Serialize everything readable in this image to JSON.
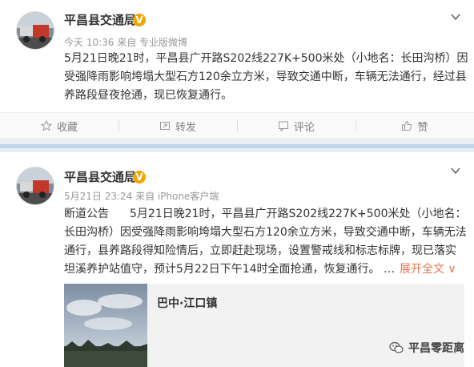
{
  "post1": {
    "author": "平昌县交通局",
    "verified_badge": "V",
    "meta": "今天 10:36 来自 专业版微博",
    "content_lines": [
      "5月21日晚21时，平昌县广开路S202线227K+500米处（小地名：长田沟桥）因",
      "受强降雨影响垮塌大型石方120余立方米，导致交通中断，车辆无法通行，经过县",
      "养路段昼夜抢通，现已恢复通行。"
    ],
    "actions": {
      "favorite": "收藏",
      "repost": "转发",
      "comment": "评论",
      "like": "赞"
    }
  },
  "post2": {
    "author": "平昌县交通局",
    "verified_badge": "V",
    "meta": "5月21日 23:24 来自 iPhone客户端",
    "first_line_label": "断道公告",
    "first_line_rest": "5月21日晚21时，平昌县广开路S202线227K+500米处（小地名：",
    "content_lines": [
      "长田沟桥）因受强降雨影响垮塌大型石方120余立方米，导致交通中断，车辆无法",
      "通行，县养路段得知险情后，立即赶赴现场，设置警戒线和标志标牌，现已落实",
      "坦溪养护站值守，预计5月22日下午14时全面抢通，恢复通行。 …"
    ],
    "expand_label": "展开全文",
    "expand_arrow": "∨",
    "location_card_title": "巴中·江口镇"
  },
  "watermark": "平昌零距离",
  "icons": {
    "more": "chevron-down-icon",
    "favorite": "star-icon",
    "repost": "repost-icon",
    "comment": "comment-icon",
    "like": "thumbs-up-icon",
    "watermark": "wechat-icon"
  },
  "colors": {
    "verified": "#f0a500",
    "expand": "#eb7350",
    "meta_text": "#999999",
    "separator": "#bdd6ea"
  }
}
